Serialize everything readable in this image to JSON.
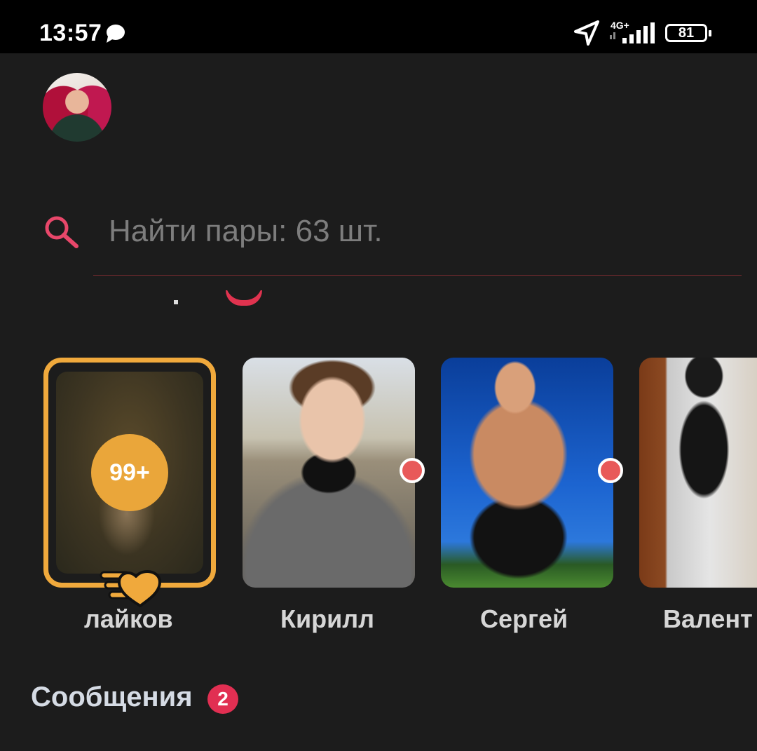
{
  "status_bar": {
    "time": "13:57",
    "network": "4G+",
    "battery": "81",
    "icons": [
      "chat-bubble-icon",
      "location-arrow-icon",
      "signal-icon",
      "battery-icon"
    ]
  },
  "profile": {
    "avatar_icon": "user-avatar"
  },
  "search": {
    "placeholder": "Найти пары: 63 шт.",
    "icon": "search-icon",
    "accent_color": "#e8476a"
  },
  "matches": {
    "likes_card": {
      "badge": "99+",
      "label": "лайков",
      "accent_color": "#f0a93c"
    },
    "people": [
      {
        "name": "Кирилл",
        "online": true
      },
      {
        "name": "Сергей",
        "online": true
      },
      {
        "name": "Валент",
        "online": false
      }
    ]
  },
  "messages": {
    "title": "Сообщения",
    "count": "2",
    "badge_color": "#e12f52"
  }
}
